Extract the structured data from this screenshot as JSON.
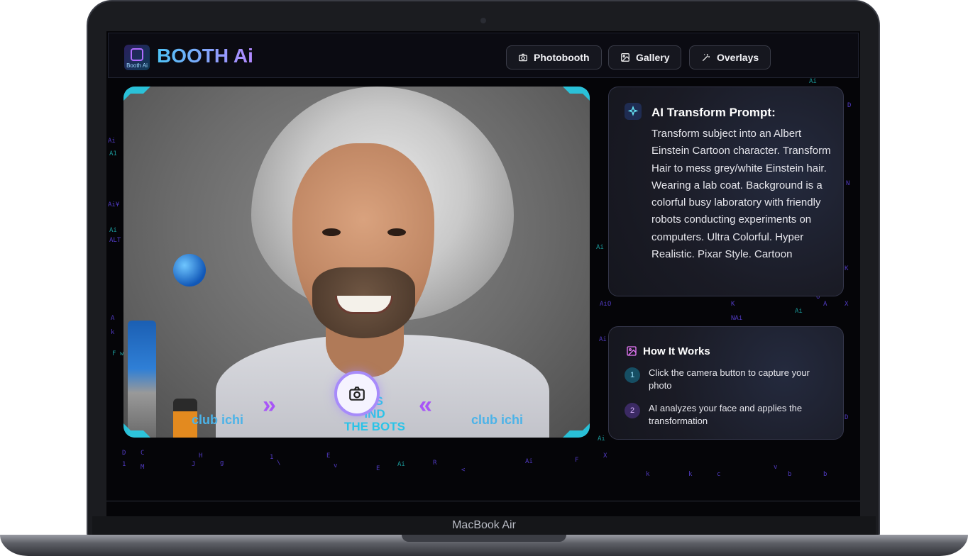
{
  "app": {
    "title": "BOOTH Ai",
    "logo_text": "Booth Ai"
  },
  "nav": [
    {
      "label": "Photobooth",
      "icon": "camera-icon"
    },
    {
      "label": "Gallery",
      "icon": "image-icon"
    },
    {
      "label": "Overlays",
      "icon": "magic-wand-icon"
    }
  ],
  "photo": {
    "overlay_brand_left": "club ichi",
    "overlay_brand_right": "club ichi",
    "overlay_text": "THE BOTS",
    "overlay_text_top": "NS\nIND"
  },
  "prompt": {
    "title": "AI Transform Prompt:",
    "text": "Transform subject into an Albert Einstein Cartoon character. Transform Hair to mess grey/white Einstein hair. Wearing a lab coat. Background is a colorful busy laboratory with friendly robots conducting experiments on computers. Ultra Colorful. Hyper Realistic. Pixar Style. Cartoon"
  },
  "how_it_works": {
    "title": "How It Works",
    "steps": [
      {
        "num": "1",
        "text": "Click the camera button to capture your photo"
      },
      {
        "num": "2",
        "text": "AI analyzes your face and applies the transformation"
      }
    ]
  },
  "device": {
    "label": "MacBook Air"
  },
  "colors": {
    "accent_cyan": "#29c4e8",
    "accent_purple": "#a78bfa",
    "background": "#050508"
  }
}
